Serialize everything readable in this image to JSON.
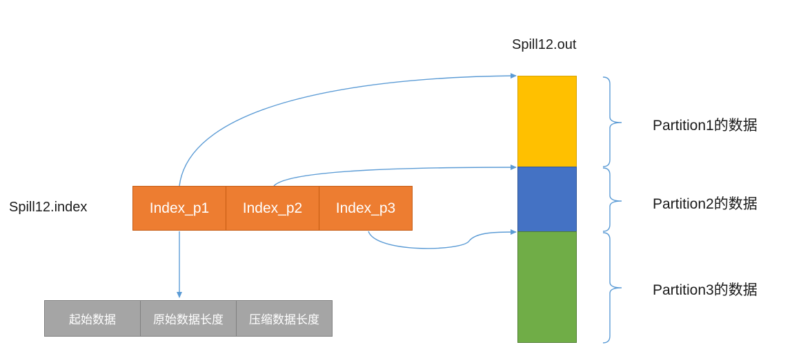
{
  "out_file": {
    "title": "Spill12.out"
  },
  "index_file": {
    "title": "Spill12.index",
    "cells": [
      "Index_p1",
      "Index_p2",
      "Index_p3"
    ]
  },
  "index_entry": {
    "fields": [
      "起始数据",
      "原始数据长度",
      "压缩数据长度"
    ]
  },
  "partitions": [
    {
      "label": "Partition1的数据",
      "color": "#ffc000"
    },
    {
      "label": "Partition2的数据",
      "color": "#4472c4"
    },
    {
      "label": "Partition3的数据",
      "color": "#70ad47"
    }
  ],
  "colors": {
    "index_cell": "#ed7d31",
    "entry_cell": "#a5a5a5",
    "arrow": "#5b9bd5"
  }
}
